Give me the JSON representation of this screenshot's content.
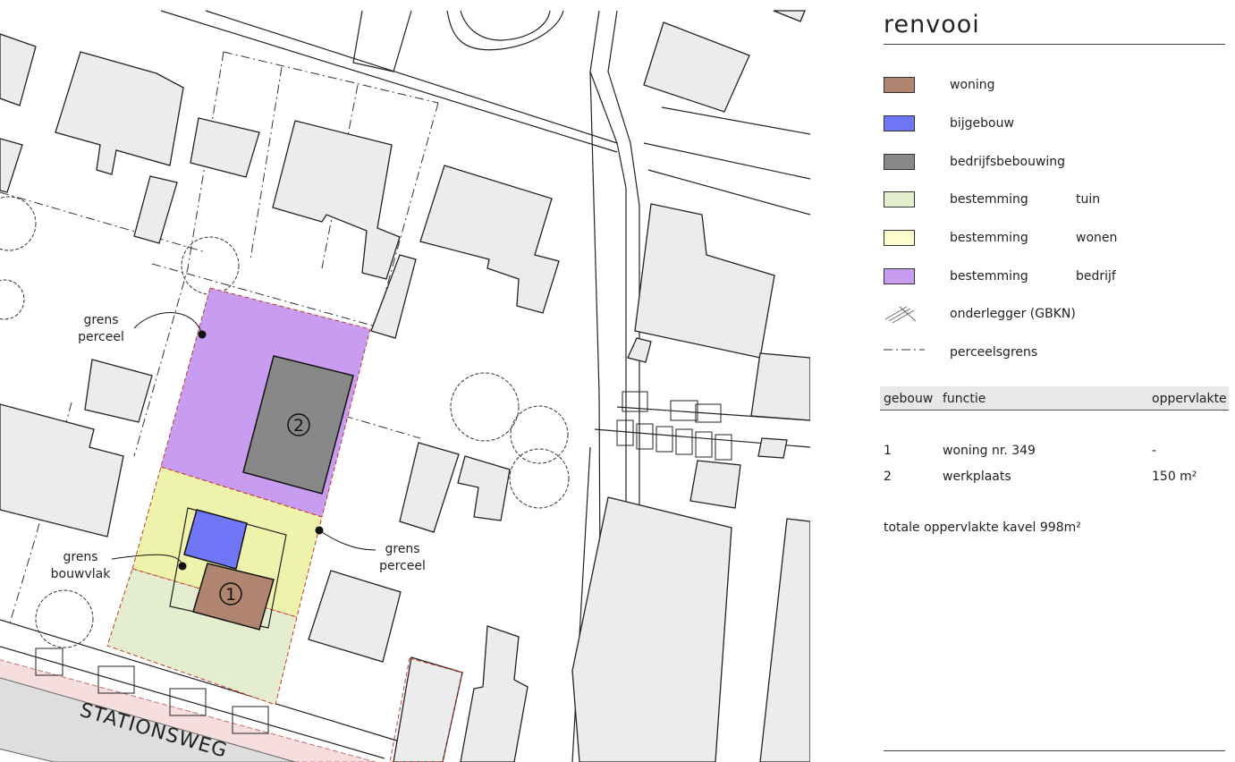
{
  "map": {
    "street_name": "STATIONSWEG",
    "annotations": {
      "grens_perceel_left": [
        "grens",
        "perceel"
      ],
      "grens_bouwvlak": [
        "grens",
        "bouwvlak"
      ],
      "grens_perceel_right": [
        "grens",
        "perceel"
      ]
    },
    "building_badges": [
      "1",
      "2"
    ],
    "colors": {
      "woning": "#b08570",
      "bijgebouw": "#7077f7",
      "bedrijfsbebouwing": "#888888",
      "tuin": "#e5edcf",
      "wonen": "#eef3ac",
      "bedrijf": "#c89cf0",
      "background_building": "#ececec",
      "parcel_line": "#c0392b"
    }
  },
  "legend": {
    "title": "renvooi",
    "items": [
      {
        "key": "woning",
        "label": "woning",
        "sub": "",
        "color": "#b08570",
        "icon": "swatch"
      },
      {
        "key": "bijgebouw",
        "label": "bijgebouw",
        "sub": "",
        "color": "#7077f7",
        "icon": "swatch"
      },
      {
        "key": "bedrijfsbebouwing",
        "label": "bedrijfsbebouwing",
        "sub": "",
        "color": "#888888",
        "icon": "swatch"
      },
      {
        "key": "tuin",
        "label": "bestemming",
        "sub": "tuin",
        "color": "#e5edcf",
        "icon": "swatch"
      },
      {
        "key": "wonen",
        "label": "bestemming",
        "sub": "wonen",
        "color": "#fdfccd",
        "icon": "swatch"
      },
      {
        "key": "bedrijf",
        "label": "bestemming",
        "sub": "bedrijf",
        "color": "#c89cf0",
        "icon": "swatch"
      },
      {
        "key": "onderlegger",
        "label": "onderlegger (GBKN)",
        "sub": "",
        "color": "",
        "icon": "hatch-lines-icon"
      },
      {
        "key": "perceelsgrens",
        "label": "perceelsgrens",
        "sub": "",
        "color": "",
        "icon": "dash-dot-line-icon"
      }
    ]
  },
  "table": {
    "headers": {
      "gebouw": "gebouw",
      "functie": "functie",
      "oppervlakte": "oppervlakte"
    },
    "rows": [
      {
        "gebouw": "1",
        "functie": "woning nr. 349",
        "oppervlakte": "-"
      },
      {
        "gebouw": "2",
        "functie": "werkplaats",
        "oppervlakte": "150 m²"
      }
    ],
    "total": "totale oppervlakte kavel 998m²"
  }
}
